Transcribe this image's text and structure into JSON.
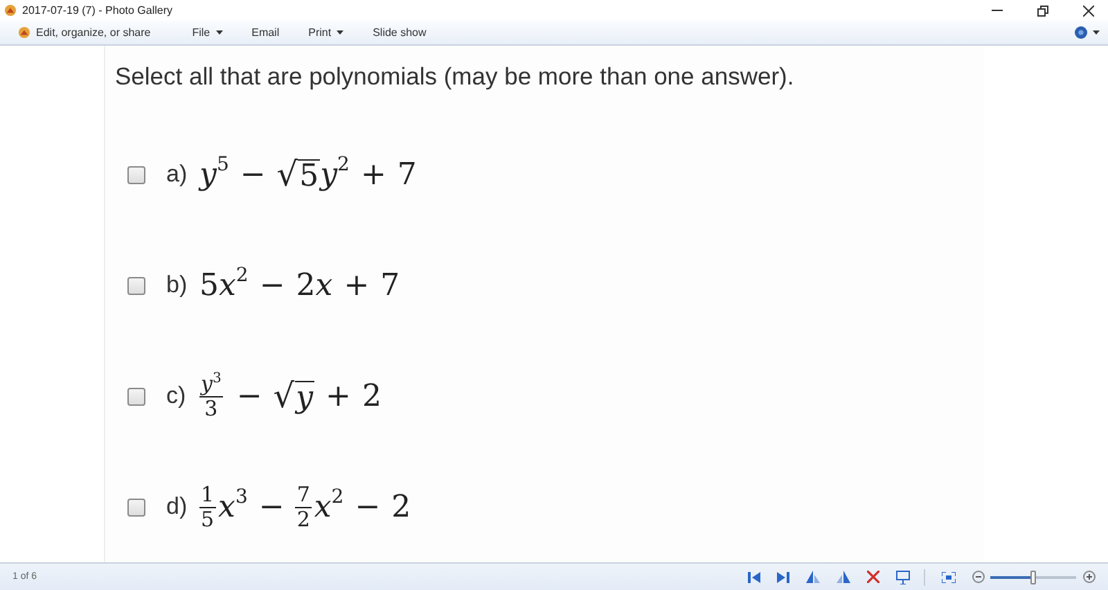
{
  "window": {
    "title": "2017-07-19 (7) - Photo Gallery"
  },
  "toolbar": {
    "items": [
      {
        "kind": "edit",
        "label": "Edit, organize, or share",
        "dropdown": false
      },
      {
        "kind": "menu",
        "label": "File",
        "dropdown": true
      },
      {
        "kind": "menu",
        "label": "Email",
        "dropdown": false
      },
      {
        "kind": "menu",
        "label": "Print",
        "dropdown": true
      },
      {
        "kind": "menu",
        "label": "Slide show",
        "dropdown": false
      }
    ]
  },
  "photo": {
    "question": "Select all that are polynomials (may be more than one answer).",
    "options": [
      {
        "label": "a)",
        "checked": false,
        "expression": [
          {
            "kind": "term",
            "text": "*y*$^{5}$"
          },
          {
            "kind": "op",
            "text": "−"
          },
          {
            "kind": "sqrt",
            "sign": "√",
            "text": "5"
          },
          {
            "kind": "term",
            "text": "*y*$^{2}$"
          },
          {
            "kind": "op",
            "text": "+"
          },
          {
            "kind": "term",
            "text": "7"
          }
        ]
      },
      {
        "label": "b)",
        "checked": false,
        "expression": [
          {
            "kind": "term",
            "text": "5"
          },
          {
            "kind": "term",
            "text": "*x*$^{2}$"
          },
          {
            "kind": "op",
            "text": "−"
          },
          {
            "kind": "term",
            "text": "2"
          },
          {
            "kind": "term",
            "text": "*x*"
          },
          {
            "kind": "op",
            "text": "+"
          },
          {
            "kind": "term",
            "text": "7"
          }
        ]
      },
      {
        "label": "c)",
        "checked": false,
        "expression": [
          {
            "kind": "frac",
            "numerator": "*y*$^{3}$",
            "denominator": "3"
          },
          {
            "kind": "op",
            "text": "−"
          },
          {
            "kind": "sqrt",
            "sign": "√",
            "text": "*y*"
          },
          {
            "kind": "op",
            "text": "+"
          },
          {
            "kind": "term",
            "text": "2"
          }
        ]
      },
      {
        "label": "d)",
        "checked": false,
        "expression": [
          {
            "kind": "frac",
            "numerator": "1",
            "denominator": "5"
          },
          {
            "kind": "term",
            "text": "*x*$^{3}$"
          },
          {
            "kind": "op",
            "text": "−"
          },
          {
            "kind": "frac",
            "numerator": "7",
            "denominator": "2"
          },
          {
            "kind": "term",
            "text": "*x*$^{2}$"
          },
          {
            "kind": "op",
            "text": "−"
          },
          {
            "kind": "term",
            "text": "2"
          }
        ]
      }
    ]
  },
  "status_bar": {
    "position": "1 of 6",
    "zoom": {
      "level": 0.5
    }
  }
}
